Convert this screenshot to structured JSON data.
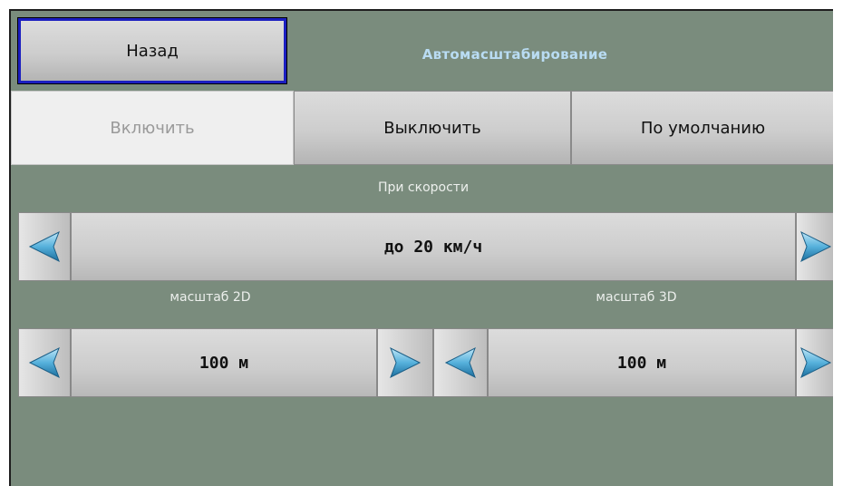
{
  "header": {
    "back_label": "Назад",
    "title": "Автомасштабирование"
  },
  "toggle": {
    "enable_label": "Включить",
    "disable_label": "Выключить",
    "default_label": "По умолчанию",
    "selected": "Включить"
  },
  "speed": {
    "caption": "При скорости",
    "value": "до 20 км/ч"
  },
  "scale2d": {
    "caption": "масштаб 2D",
    "value": "100 м"
  },
  "scale3d": {
    "caption": "масштаб 3D",
    "value": "100 м"
  },
  "icons": {
    "left": "triangle-left-icon",
    "right": "triangle-right-icon"
  },
  "colors": {
    "background": "#7a8c7d",
    "title": "#b9dcf3",
    "focus_border": "#1b1fc0",
    "arrow": "#3a8fbf"
  }
}
